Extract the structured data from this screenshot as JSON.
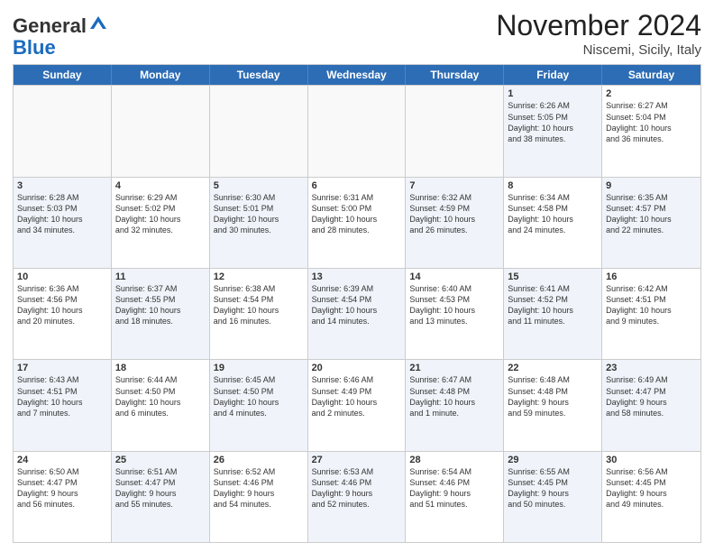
{
  "header": {
    "logo_general": "General",
    "logo_blue": "Blue",
    "month_title": "November 2024",
    "location": "Niscemi, Sicily, Italy"
  },
  "calendar": {
    "days_of_week": [
      "Sunday",
      "Monday",
      "Tuesday",
      "Wednesday",
      "Thursday",
      "Friday",
      "Saturday"
    ],
    "weeks": [
      [
        {
          "day": "",
          "info": "",
          "empty": true
        },
        {
          "day": "",
          "info": "",
          "empty": true
        },
        {
          "day": "",
          "info": "",
          "empty": true
        },
        {
          "day": "",
          "info": "",
          "empty": true
        },
        {
          "day": "",
          "info": "",
          "empty": true
        },
        {
          "day": "1",
          "info": "Sunrise: 6:26 AM\nSunset: 5:05 PM\nDaylight: 10 hours\nand 38 minutes.",
          "shaded": true
        },
        {
          "day": "2",
          "info": "Sunrise: 6:27 AM\nSunset: 5:04 PM\nDaylight: 10 hours\nand 36 minutes.",
          "shaded": false
        }
      ],
      [
        {
          "day": "3",
          "info": "Sunrise: 6:28 AM\nSunset: 5:03 PM\nDaylight: 10 hours\nand 34 minutes.",
          "shaded": true
        },
        {
          "day": "4",
          "info": "Sunrise: 6:29 AM\nSunset: 5:02 PM\nDaylight: 10 hours\nand 32 minutes.",
          "shaded": false
        },
        {
          "day": "5",
          "info": "Sunrise: 6:30 AM\nSunset: 5:01 PM\nDaylight: 10 hours\nand 30 minutes.",
          "shaded": true
        },
        {
          "day": "6",
          "info": "Sunrise: 6:31 AM\nSunset: 5:00 PM\nDaylight: 10 hours\nand 28 minutes.",
          "shaded": false
        },
        {
          "day": "7",
          "info": "Sunrise: 6:32 AM\nSunset: 4:59 PM\nDaylight: 10 hours\nand 26 minutes.",
          "shaded": true
        },
        {
          "day": "8",
          "info": "Sunrise: 6:34 AM\nSunset: 4:58 PM\nDaylight: 10 hours\nand 24 minutes.",
          "shaded": false
        },
        {
          "day": "9",
          "info": "Sunrise: 6:35 AM\nSunset: 4:57 PM\nDaylight: 10 hours\nand 22 minutes.",
          "shaded": true
        }
      ],
      [
        {
          "day": "10",
          "info": "Sunrise: 6:36 AM\nSunset: 4:56 PM\nDaylight: 10 hours\nand 20 minutes.",
          "shaded": false
        },
        {
          "day": "11",
          "info": "Sunrise: 6:37 AM\nSunset: 4:55 PM\nDaylight: 10 hours\nand 18 minutes.",
          "shaded": true
        },
        {
          "day": "12",
          "info": "Sunrise: 6:38 AM\nSunset: 4:54 PM\nDaylight: 10 hours\nand 16 minutes.",
          "shaded": false
        },
        {
          "day": "13",
          "info": "Sunrise: 6:39 AM\nSunset: 4:54 PM\nDaylight: 10 hours\nand 14 minutes.",
          "shaded": true
        },
        {
          "day": "14",
          "info": "Sunrise: 6:40 AM\nSunset: 4:53 PM\nDaylight: 10 hours\nand 13 minutes.",
          "shaded": false
        },
        {
          "day": "15",
          "info": "Sunrise: 6:41 AM\nSunset: 4:52 PM\nDaylight: 10 hours\nand 11 minutes.",
          "shaded": true
        },
        {
          "day": "16",
          "info": "Sunrise: 6:42 AM\nSunset: 4:51 PM\nDaylight: 10 hours\nand 9 minutes.",
          "shaded": false
        }
      ],
      [
        {
          "day": "17",
          "info": "Sunrise: 6:43 AM\nSunset: 4:51 PM\nDaylight: 10 hours\nand 7 minutes.",
          "shaded": true
        },
        {
          "day": "18",
          "info": "Sunrise: 6:44 AM\nSunset: 4:50 PM\nDaylight: 10 hours\nand 6 minutes.",
          "shaded": false
        },
        {
          "day": "19",
          "info": "Sunrise: 6:45 AM\nSunset: 4:50 PM\nDaylight: 10 hours\nand 4 minutes.",
          "shaded": true
        },
        {
          "day": "20",
          "info": "Sunrise: 6:46 AM\nSunset: 4:49 PM\nDaylight: 10 hours\nand 2 minutes.",
          "shaded": false
        },
        {
          "day": "21",
          "info": "Sunrise: 6:47 AM\nSunset: 4:48 PM\nDaylight: 10 hours\nand 1 minute.",
          "shaded": true
        },
        {
          "day": "22",
          "info": "Sunrise: 6:48 AM\nSunset: 4:48 PM\nDaylight: 9 hours\nand 59 minutes.",
          "shaded": false
        },
        {
          "day": "23",
          "info": "Sunrise: 6:49 AM\nSunset: 4:47 PM\nDaylight: 9 hours\nand 58 minutes.",
          "shaded": true
        }
      ],
      [
        {
          "day": "24",
          "info": "Sunrise: 6:50 AM\nSunset: 4:47 PM\nDaylight: 9 hours\nand 56 minutes.",
          "shaded": false
        },
        {
          "day": "25",
          "info": "Sunrise: 6:51 AM\nSunset: 4:47 PM\nDaylight: 9 hours\nand 55 minutes.",
          "shaded": true
        },
        {
          "day": "26",
          "info": "Sunrise: 6:52 AM\nSunset: 4:46 PM\nDaylight: 9 hours\nand 54 minutes.",
          "shaded": false
        },
        {
          "day": "27",
          "info": "Sunrise: 6:53 AM\nSunset: 4:46 PM\nDaylight: 9 hours\nand 52 minutes.",
          "shaded": true
        },
        {
          "day": "28",
          "info": "Sunrise: 6:54 AM\nSunset: 4:46 PM\nDaylight: 9 hours\nand 51 minutes.",
          "shaded": false
        },
        {
          "day": "29",
          "info": "Sunrise: 6:55 AM\nSunset: 4:45 PM\nDaylight: 9 hours\nand 50 minutes.",
          "shaded": true
        },
        {
          "day": "30",
          "info": "Sunrise: 6:56 AM\nSunset: 4:45 PM\nDaylight: 9 hours\nand 49 minutes.",
          "shaded": false
        }
      ]
    ]
  }
}
